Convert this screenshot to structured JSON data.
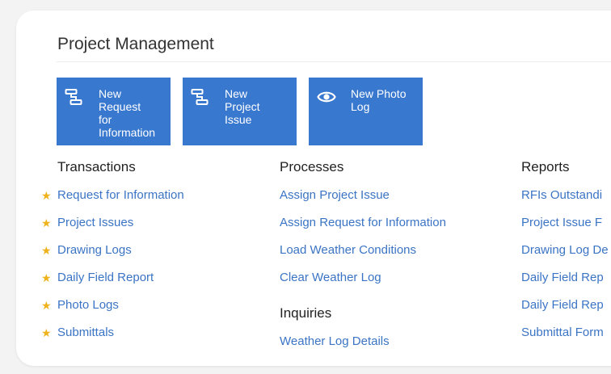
{
  "page": {
    "title": "Project Management"
  },
  "tiles": [
    {
      "icon": "flowchart-icon",
      "lines": [
        "New",
        "Request",
        "for",
        "Information"
      ]
    },
    {
      "icon": "flowchart-icon",
      "lines": [
        "New",
        "Project",
        "Issue"
      ]
    },
    {
      "icon": "eye-icon",
      "lines": [
        "New Photo",
        "Log"
      ]
    }
  ],
  "columns": {
    "transactions": {
      "title": "Transactions",
      "items": [
        "Request for Information",
        "Project Issues",
        "Drawing Logs",
        "Daily Field Report",
        "Photo Logs",
        "Submittals"
      ]
    },
    "processes": {
      "title": "Processes",
      "items": [
        "Assign Project Issue",
        "Assign Request for Information",
        "Load Weather Conditions",
        "Clear Weather Log"
      ]
    },
    "inquiries": {
      "title": "Inquiries",
      "items": [
        "Weather Log Details"
      ]
    },
    "reports": {
      "title": "Reports",
      "items": [
        "RFIs Outstandi",
        "Project Issue F",
        "Drawing Log De",
        "Daily Field Rep",
        "Daily Field Rep",
        "Submittal Form"
      ]
    }
  },
  "colors": {
    "accent": "#3978cf",
    "link": "#3b74c4",
    "star": "#f0b21c"
  }
}
